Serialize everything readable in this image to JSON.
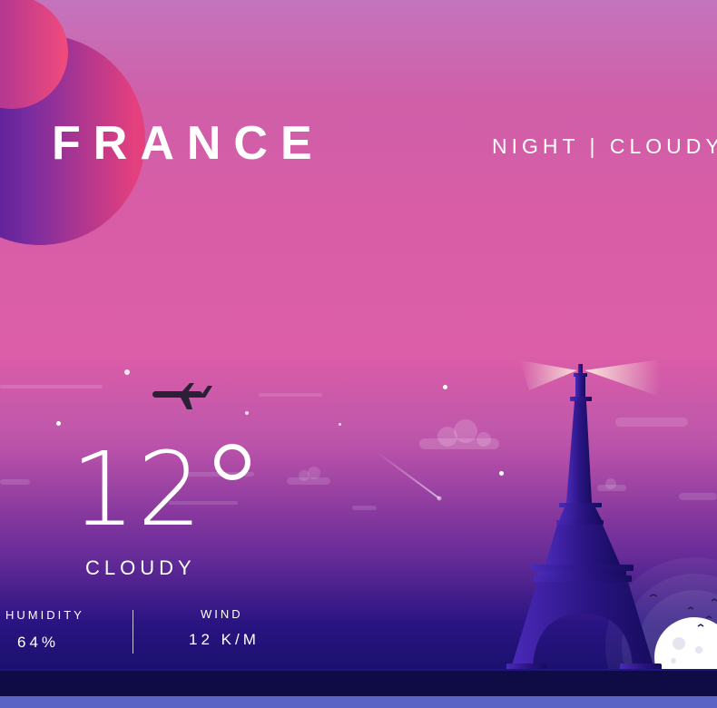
{
  "header": {
    "country": "FRANCE",
    "condition_line": "NIGHT | CLOUDY"
  },
  "weather": {
    "temperature": "12",
    "description": "CLOUDY",
    "humidity_label": "HUMIDITY",
    "humidity_value": "64%",
    "wind_label": "WIND",
    "wind_value": "12 K/M"
  },
  "colors": {
    "sky_top": "#c474bd",
    "sky_mid": "#dc5ea8",
    "sky_bottom": "#2a1482",
    "accent_pink": "#f24b7c",
    "tower": "#2a1480",
    "ground": "#0e0b45",
    "water": "#5b63c4"
  }
}
